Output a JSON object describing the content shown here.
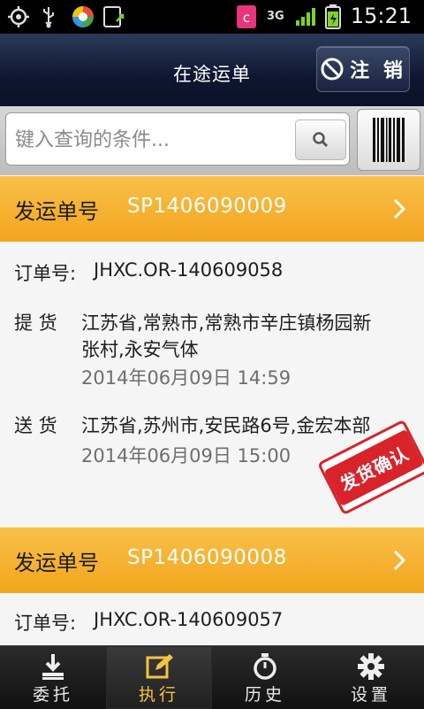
{
  "status_bar": {
    "time": "15:21",
    "net_3g": "3G",
    "net_3g_sub": "3G"
  },
  "header": {
    "title": "在途运单",
    "logout_label": "注 销"
  },
  "search": {
    "placeholder": "键入查询的条件..."
  },
  "orders": [
    {
      "header_label": "发运单号",
      "shipment_no": "SP1406090009",
      "order_label": "订单号:",
      "order_no": "JHXC.OR-140609058",
      "pickup_label": "提 货",
      "pickup_address_line1": "江苏省,常熟市,常熟市辛庄镇杨园新",
      "pickup_address_line2": "张村,永安气体",
      "pickup_time": "2014年06月09日 14:59",
      "delivery_label": "送 货",
      "delivery_address": "江苏省,苏州市,安民路6号,金宏本部",
      "delivery_time": "2014年06月09日 15:00",
      "stamp": "发货确认"
    },
    {
      "header_label": "发运单号",
      "shipment_no": "SP1406090008",
      "order_label": "订单号:",
      "order_no": "JHXC.OR-140609057"
    }
  ],
  "tabs": [
    {
      "label": "委托",
      "icon": "download-icon"
    },
    {
      "label": "执行",
      "icon": "edit-icon"
    },
    {
      "label": "历史",
      "icon": "stopwatch-icon"
    },
    {
      "label": "设置",
      "icon": "gear-icon"
    }
  ],
  "colors": {
    "accent": "#f2a51d",
    "title_bar": "#0e1730",
    "stamp_red": "#d8232a"
  }
}
